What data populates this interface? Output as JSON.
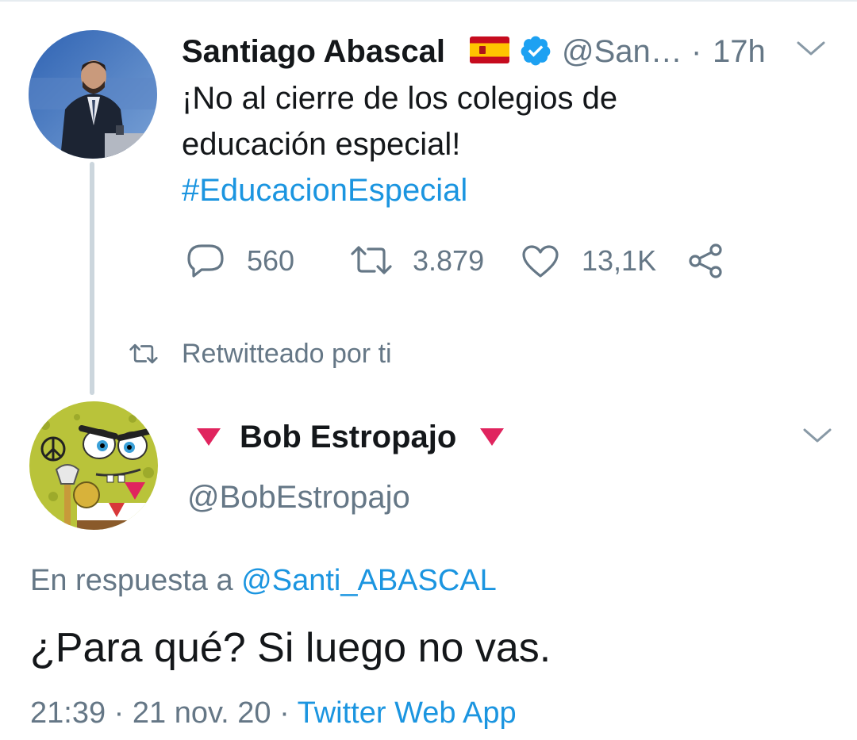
{
  "tweet1": {
    "display_name": "Santiago Abascal",
    "handle": "@San…",
    "time_sep": "·",
    "time": "17h",
    "text_line1": "¡No al cierre de los colegios de",
    "text_line2": "educación especial!",
    "hashtag": "#EducacionEspecial",
    "replies": "560",
    "retweets": "3.879",
    "likes": "13,1K"
  },
  "retweet_notice": "Retwitteado por ti",
  "tweet2": {
    "display_name": "Bob Estropajo",
    "handle": "@BobEstropajo",
    "reply_prefix": "En respuesta a",
    "reply_to": "@Santi_ABASCAL",
    "text": "¿Para qué? Si luego no vas.",
    "timestamp": "21:39 · 21 nov. 20 ·",
    "source": "Twitter Web App"
  },
  "colors": {
    "link": "#1b95e0",
    "muted": "#657786",
    "verified": "#1da1f2",
    "red_triangle": "#e0245e",
    "thread_line": "#ccd6dd"
  }
}
